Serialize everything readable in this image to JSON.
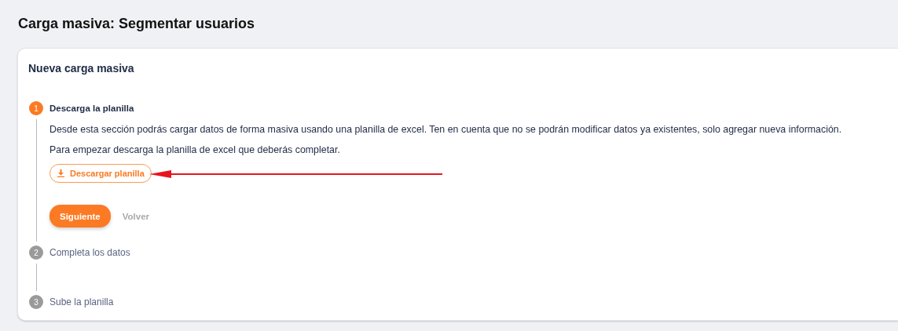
{
  "page_title": "Carga masiva: Segmentar usuarios",
  "card_title": "Nueva carga masiva",
  "steps": [
    {
      "number": "1",
      "label": "Descarga la planilla",
      "active": true,
      "paragraphs": [
        "Desde esta sección podrás cargar datos de forma masiva usando una planilla de excel. Ten en cuenta que no se podrán modificar datos ya existentes, solo agregar nueva información.",
        "Para empezar descarga la planilla de excel que deberás completar."
      ],
      "download_button": "Descargar planilla",
      "annotation_arrow": true,
      "primary_button": "Siguiente",
      "secondary_button": "Volver"
    },
    {
      "number": "2",
      "label": "Completa los datos",
      "active": false
    },
    {
      "number": "3",
      "label": "Sube la planilla",
      "active": false
    }
  ]
}
